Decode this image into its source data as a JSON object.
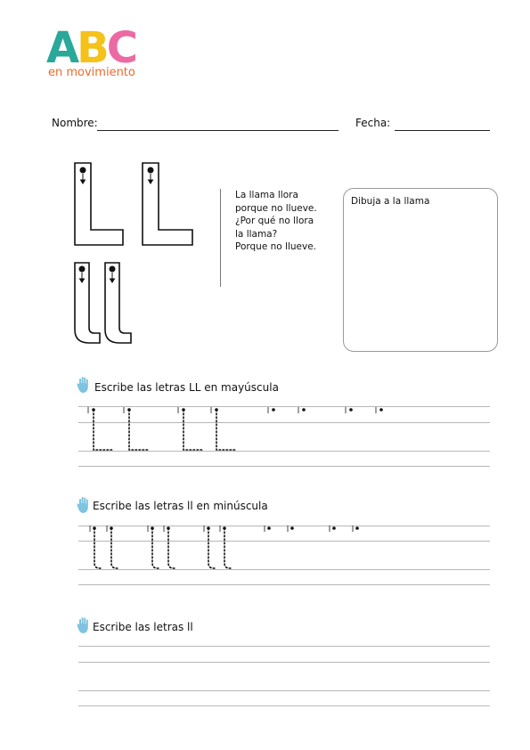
{
  "logo": {
    "letter_a": "A",
    "letter_b": "B",
    "letter_c": "C",
    "subtitle": "en movimiento"
  },
  "header": {
    "name_label": "Nombre:",
    "date_label": "Fecha:"
  },
  "poem": {
    "lines": [
      "La llama llora",
      "porque no llueve.",
      "¿Por qué no llora",
      "la llama?",
      "Porque no llueve."
    ]
  },
  "draw_box": {
    "label": "Dibuja a la llama"
  },
  "sections": [
    {
      "title": "Escribe las letras LL en mayúscula"
    },
    {
      "title": "Escribe las letras ll en minúscula"
    },
    {
      "title": "Escribe las letras ll"
    }
  ],
  "colors": {
    "hand_icon": "#7ec3df",
    "logo_a": "#2aa89a",
    "logo_b": "#f5c21b",
    "logo_c": "#ec6aa3",
    "logo_sub": "#ea6a2c"
  }
}
